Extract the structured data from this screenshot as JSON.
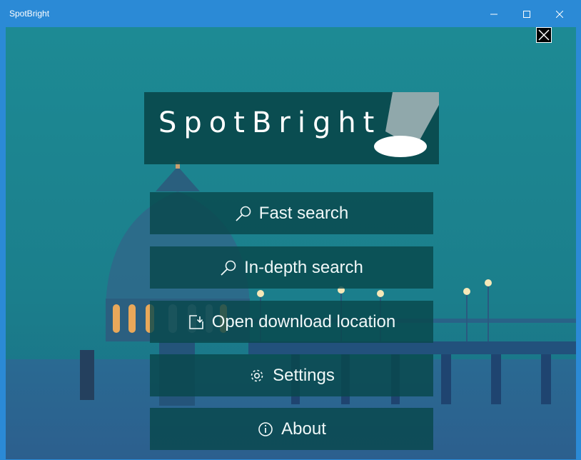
{
  "window": {
    "title": "SpotBright",
    "controls": [
      "minimize-icon",
      "maximize-icon",
      "close-icon"
    ]
  },
  "app": {
    "logo_text": "SpotBright",
    "logo_icon": "spotlight-icon",
    "overlay_close_icon": "close-icon"
  },
  "menu": [
    {
      "label": "Fast search",
      "icon": "search-icon"
    },
    {
      "label": "In-depth search",
      "icon": "search-icon"
    },
    {
      "label": "Open download location",
      "icon": "folder-open-icon"
    },
    {
      "label": "Settings",
      "icon": "gear-icon"
    },
    {
      "label": "About",
      "icon": "info-icon"
    }
  ],
  "colors": {
    "titlebar": "#2b8ad6",
    "background_teal": "#1e7f8e",
    "panel": "#084648"
  }
}
